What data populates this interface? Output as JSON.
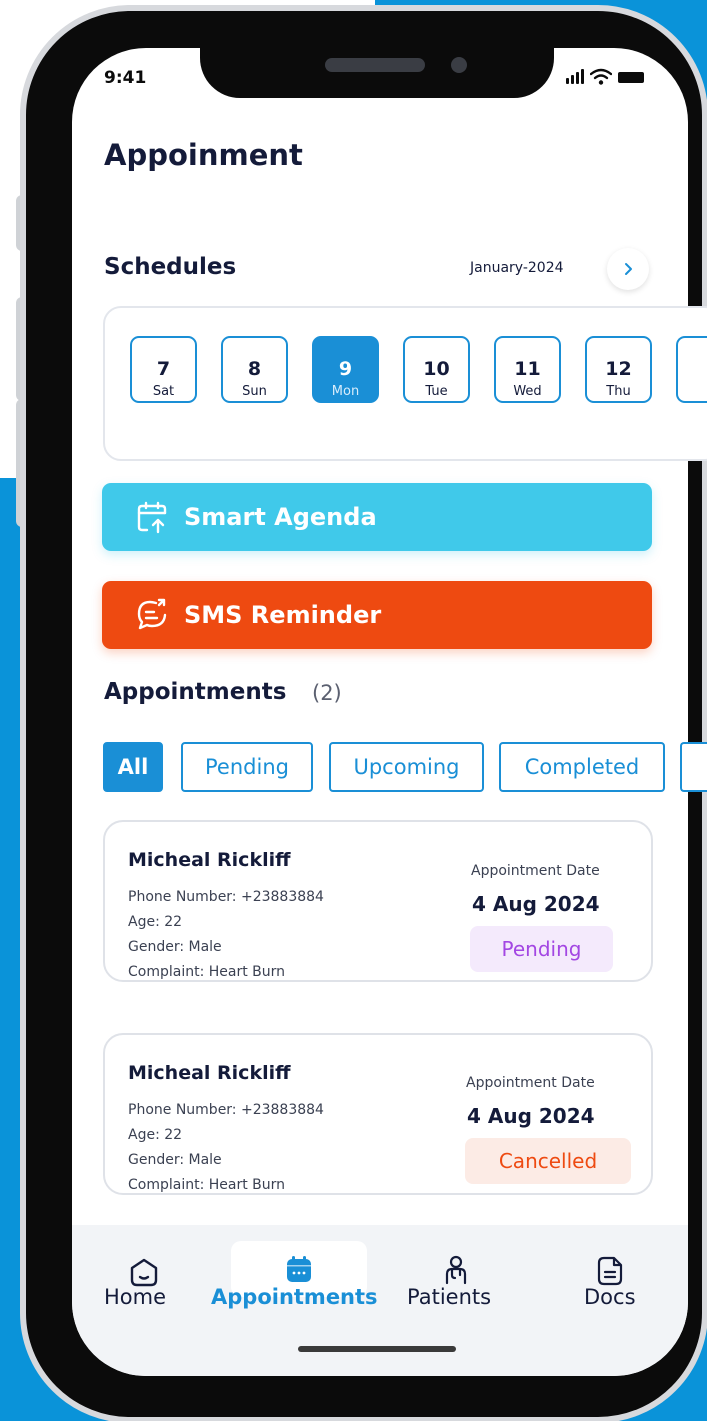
{
  "status": {
    "time": "9:41"
  },
  "page": {
    "title": "Appoinment"
  },
  "schedules": {
    "title": "Schedules",
    "month": "January-2024",
    "days": [
      {
        "num": "7",
        "dow": "Sat",
        "selected": false
      },
      {
        "num": "8",
        "dow": "Sun",
        "selected": false
      },
      {
        "num": "9",
        "dow": "Mon",
        "selected": true
      },
      {
        "num": "10",
        "dow": "Tue",
        "selected": false
      },
      {
        "num": "11",
        "dow": "Wed",
        "selected": false
      },
      {
        "num": "12",
        "dow": "Thu",
        "selected": false
      }
    ]
  },
  "actions": {
    "smart_agenda": "Smart Agenda",
    "sms_reminder": "SMS Reminder"
  },
  "appointments": {
    "title": "Appointments",
    "count": "(2)",
    "filters": [
      {
        "label": "All",
        "active": true
      },
      {
        "label": "Pending",
        "active": false
      },
      {
        "label": "Upcoming",
        "active": false
      },
      {
        "label": "Completed",
        "active": false
      }
    ],
    "items": [
      {
        "name": "Micheal Rickliff",
        "phone": "Phone Number: +23883884",
        "age": "Age: 22",
        "gender": "Gender: Male",
        "complaint": "Complaint: Heart Burn",
        "date_label": "Appointment Date",
        "date": "4 Aug 2024",
        "status": "Pending"
      },
      {
        "name": "Micheal Rickliff",
        "phone": "Phone Number: +23883884",
        "age": "Age: 22",
        "gender": "Gender: Male",
        "complaint": "Complaint: Heart Burn",
        "date_label": "Appointment Date",
        "date": "4 Aug 2024",
        "status": "Cancelled"
      }
    ]
  },
  "nav": {
    "items": [
      {
        "label": "Home",
        "icon": "home-icon",
        "active": false
      },
      {
        "label": "Appointments",
        "icon": "calendar-icon",
        "active": true
      },
      {
        "label": "Patients",
        "icon": "patient-icon",
        "active": false
      },
      {
        "label": "Docs",
        "icon": "document-icon",
        "active": false
      }
    ]
  },
  "colors": {
    "primary": "#1a8fd6",
    "agenda": "#40c9ea",
    "sms": "#ee4a11",
    "pending": "#a347e3",
    "cancelled": "#ee4a11",
    "background": "#0a93d9"
  }
}
